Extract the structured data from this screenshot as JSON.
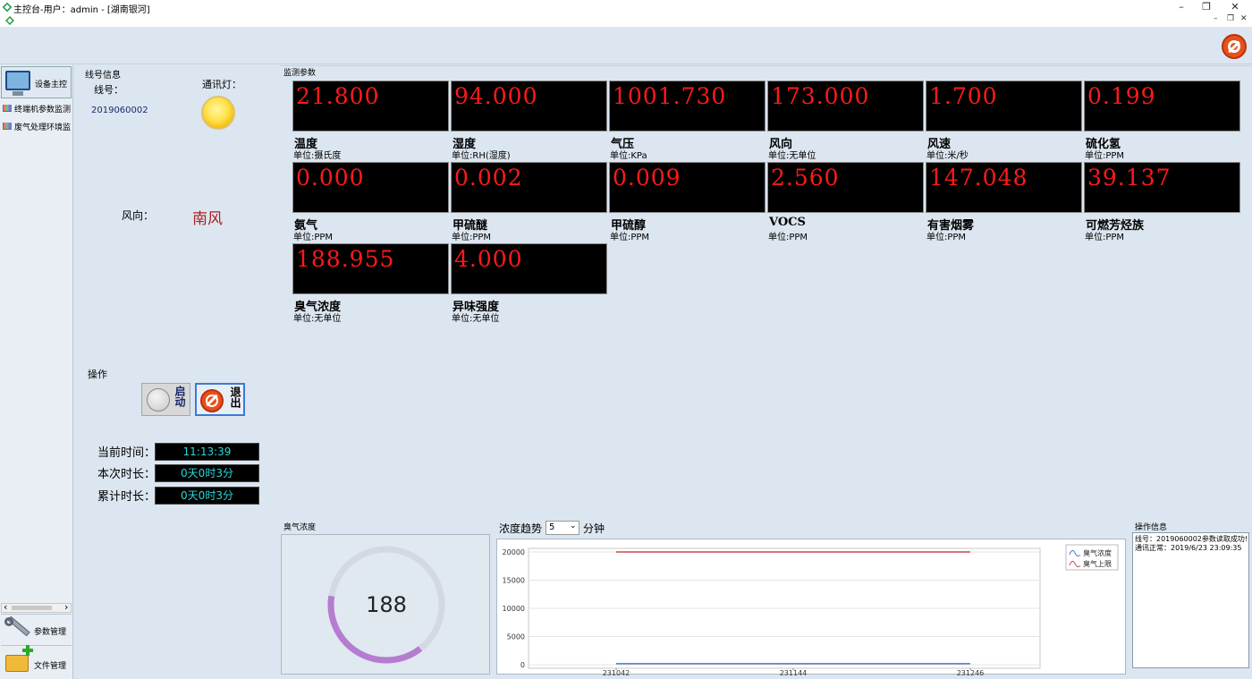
{
  "window": {
    "title": "主控台-用户：admin - [湖南银河]",
    "minimize": "–",
    "restore": "❐",
    "close": "✕",
    "inner_min": "–",
    "inner_restore": "❐",
    "inner_close": "✕"
  },
  "sidebar": {
    "items": [
      {
        "label": "设备主控"
      },
      {
        "label": "终端机参数监测"
      },
      {
        "label": "废气处理环境监"
      }
    ],
    "bottom": [
      {
        "label": "参数管理"
      },
      {
        "label": "文件管理"
      }
    ],
    "scroll_left": "‹",
    "scroll_right": "›"
  },
  "line_info": {
    "group_title": "线号信息",
    "line_label": "线号：",
    "line_value": "2019060002",
    "comm_label": "通讯灯：",
    "wind_label": "风向：",
    "wind_value": "南风"
  },
  "operation": {
    "title": "操作",
    "start_label": "启动",
    "exit_label": "退出"
  },
  "times": {
    "current_label": "当前时间：",
    "current_value": "11:13:39",
    "session_label": "本次时长：",
    "session_value": "0天0时3分",
    "total_label": "累计时长：",
    "total_value": "0天0时3分"
  },
  "monitor": {
    "title": "监测参数",
    "params": [
      {
        "value": "21.800",
        "name": "温度",
        "unit": "单位:摄氏度"
      },
      {
        "value": "94.000",
        "name": "湿度",
        "unit": "单位:RH(湿度)"
      },
      {
        "value": "1001.730",
        "name": "气压",
        "unit": "单位:KPa"
      },
      {
        "value": "173.000",
        "name": "风向",
        "unit": "单位:无单位"
      },
      {
        "value": "1.700",
        "name": "风速",
        "unit": "单位:米/秒"
      },
      {
        "value": "0.199",
        "name": "硫化氢",
        "unit": "单位:PPM"
      },
      {
        "value": "0.000",
        "name": "氨气",
        "unit": "单位:PPM"
      },
      {
        "value": "0.002",
        "name": "甲硫醚",
        "unit": "单位:PPM"
      },
      {
        "value": "0.009",
        "name": "甲硫醇",
        "unit": "单位:PPM"
      },
      {
        "value": "2.560",
        "name": "VOCS",
        "unit": "单位:PPM"
      },
      {
        "value": "147.048",
        "name": "有害烟雾",
        "unit": "单位:PPM"
      },
      {
        "value": "39.137",
        "name": "可燃芳烃族",
        "unit": "单位:PPM"
      },
      {
        "value": "188.955",
        "name": "臭气浓度",
        "unit": "单位:无单位"
      },
      {
        "value": "4.000",
        "name": "异味强度",
        "unit": "单位:无单位"
      }
    ]
  },
  "gauge": {
    "title": "臭气浓度",
    "value_text": "188",
    "fraction": 0.38,
    "track_color": "#d4d8e4",
    "fill_color": "#b57cd0"
  },
  "trend": {
    "title": "浓度趋势",
    "select_value": "5",
    "unit_label": "分钟"
  },
  "chart_data": {
    "type": "line",
    "x": [
      "231042",
      "231144",
      "231246"
    ],
    "ylim": [
      0,
      20000
    ],
    "yticks": [
      "20000",
      "15000",
      "10000",
      "5000",
      "0"
    ],
    "series": [
      {
        "name": "臭气浓度",
        "color": "#4a78c8",
        "values": [
          188,
          188,
          188
        ]
      },
      {
        "name": "臭气上限",
        "color": "#c84a4a",
        "values": [
          20000,
          20000,
          20000
        ]
      }
    ],
    "legend": "top-right"
  },
  "op_info": {
    "title": "操作信息",
    "lines": [
      "线号：2019060002参数读取成功!",
      "通讯正常：2019/6/23 23:09:35"
    ]
  }
}
